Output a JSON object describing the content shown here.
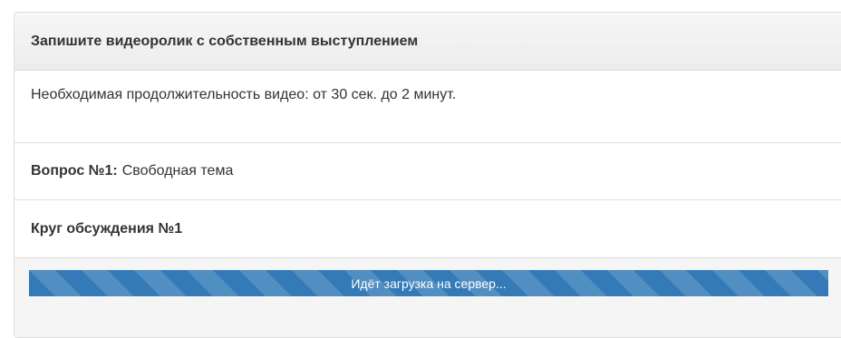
{
  "panel": {
    "title": "Запишите видеоролик с собственным выступлением"
  },
  "duration_text": "Необходимая продолжительность видео: от 30 сек. до 2 минут.",
  "question": {
    "label": "Вопрос №1:",
    "value": "Свободная тема"
  },
  "round_title": "Круг обсуждения №1",
  "upload": {
    "status_text": "Идёт загрузка на сервер...",
    "progress_percent": 100,
    "bar_color": "#337ab7"
  }
}
